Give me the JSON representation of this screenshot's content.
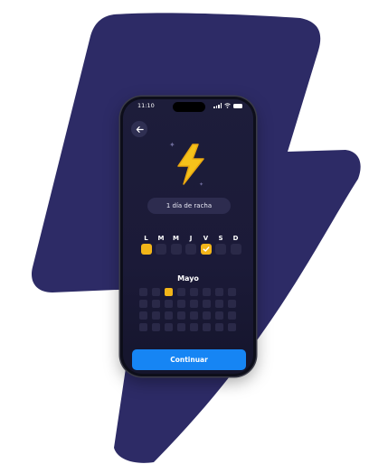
{
  "status_bar": {
    "time": "11:10"
  },
  "streak": {
    "label": "1 día de racha"
  },
  "week": {
    "days": [
      {
        "letter": "L",
        "state": "active"
      },
      {
        "letter": "M",
        "state": "empty"
      },
      {
        "letter": "M",
        "state": "empty"
      },
      {
        "letter": "J",
        "state": "empty"
      },
      {
        "letter": "V",
        "state": "checked"
      },
      {
        "letter": "S",
        "state": "empty"
      },
      {
        "letter": "D",
        "state": "empty"
      }
    ]
  },
  "calendar": {
    "month": "Mayo",
    "columns": 8,
    "cell_count": 32,
    "active_index": 2
  },
  "button": {
    "continue_label": "Continuar"
  },
  "colors": {
    "accent": "#f2b519",
    "primary_button": "#1685f4",
    "background_bolt": "#2d2b66",
    "screen_bg": "#1b1a38"
  },
  "icons": [
    "back-arrow-icon",
    "lightning-bolt-icon",
    "sparkle-icon",
    "check-icon",
    "signal-icon",
    "wifi-icon",
    "battery-icon"
  ]
}
